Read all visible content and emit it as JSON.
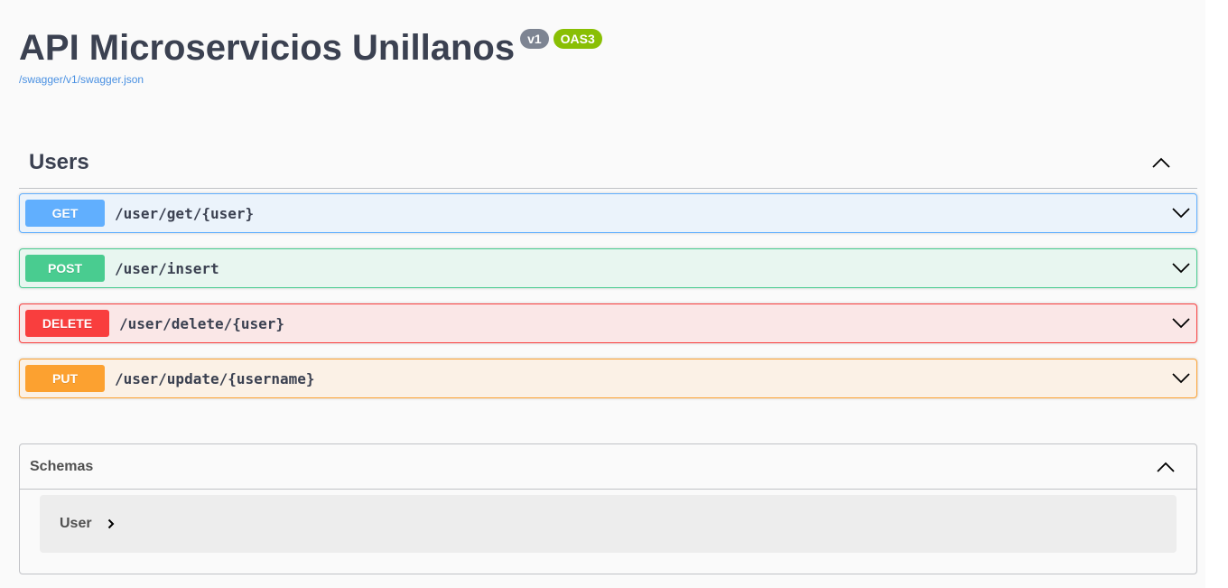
{
  "info": {
    "title": "API Microservicios Unillanos",
    "version_badge": "v1",
    "oas_badge": "OAS3",
    "spec_url": "/swagger/v1/swagger.json"
  },
  "tag": {
    "name": "Users",
    "expanded": true,
    "operations": [
      {
        "method": "GET",
        "path": "/user/get/{user}",
        "color": "#61affe"
      },
      {
        "method": "POST",
        "path": "/user/insert",
        "color": "#49cc90"
      },
      {
        "method": "DELETE",
        "path": "/user/delete/{user}",
        "color": "#f93e3e"
      },
      {
        "method": "PUT",
        "path": "/user/update/{username}",
        "color": "#fca130"
      }
    ]
  },
  "schemas": {
    "title": "Schemas",
    "expanded": true,
    "models": [
      {
        "name": "User"
      }
    ]
  },
  "icons": {
    "tag_toggle": "chevron-up-icon",
    "operation_toggle": "chevron-down-icon",
    "schemas_toggle": "chevron-up-icon",
    "model_toggle": "chevron-right-icon"
  },
  "colors": {
    "text": "#3b4151",
    "link": "#4990e2",
    "version_badge": "#7d8492",
    "oas_badge": "#89bf04",
    "background": "#fafafa"
  }
}
